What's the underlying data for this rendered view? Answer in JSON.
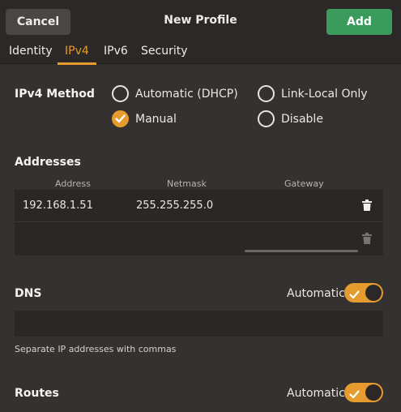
{
  "header": {
    "cancel_label": "Cancel",
    "title": "New Profile",
    "add_label": "Add"
  },
  "tabs": [
    {
      "label": "Identity",
      "active": false
    },
    {
      "label": "IPv4",
      "active": true
    },
    {
      "label": "IPv6",
      "active": false
    },
    {
      "label": "Security",
      "active": false
    }
  ],
  "ipv4_method": {
    "label": "IPv4 Method",
    "options": [
      {
        "label": "Automatic (DHCP)",
        "selected": false
      },
      {
        "label": "Link-Local Only",
        "selected": false
      },
      {
        "label": "Manual",
        "selected": true
      },
      {
        "label": "Disable",
        "selected": false
      }
    ]
  },
  "addresses": {
    "label": "Addresses",
    "columns": [
      "Address",
      "Netmask",
      "Gateway"
    ],
    "rows": [
      {
        "address": "192.168.1.51",
        "netmask": "255.255.255.0",
        "gateway": ""
      },
      {
        "address": "",
        "netmask": "",
        "gateway": ""
      }
    ]
  },
  "dns": {
    "label": "DNS",
    "automatic_label": "Automatic",
    "automatic_on": true,
    "value": "",
    "hint": "Separate IP addresses with commas"
  },
  "routes": {
    "label": "Routes",
    "automatic_label": "Automatic",
    "automatic_on": true
  },
  "colors": {
    "accent": "#e69b2f",
    "add_button": "#3a9b5c",
    "background": "#353130",
    "header": "#2b2827"
  }
}
